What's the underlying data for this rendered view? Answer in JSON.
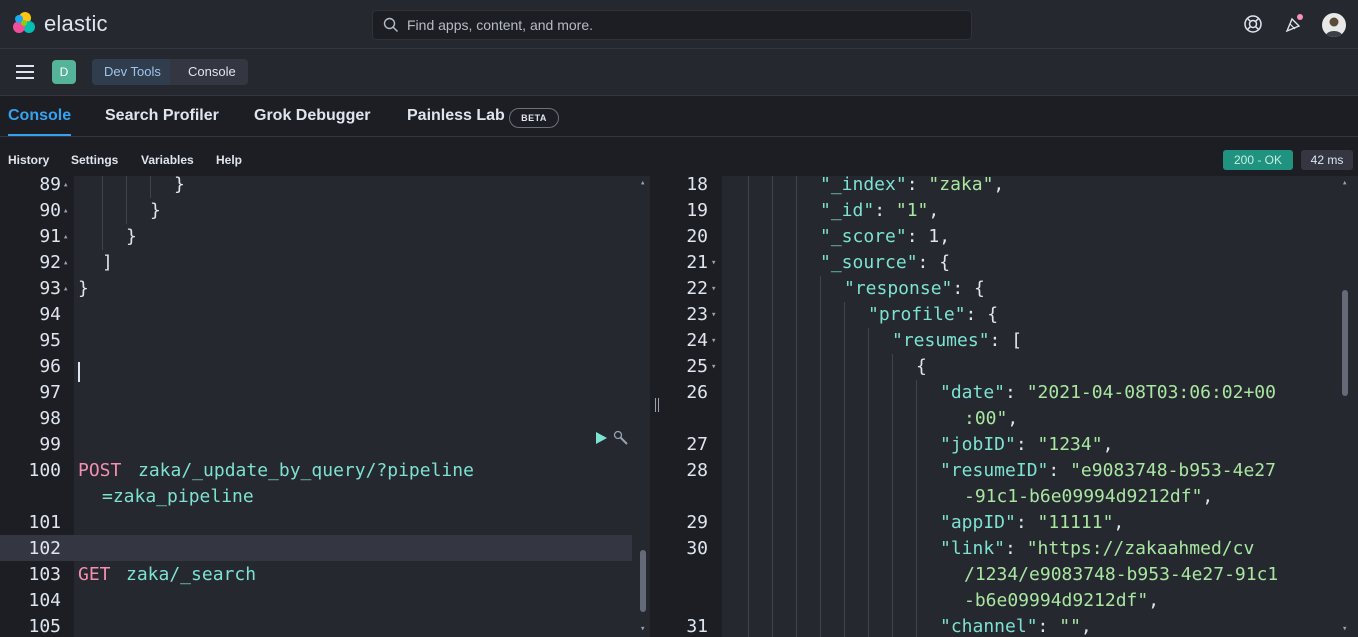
{
  "header": {
    "logo_text": "elastic",
    "search_placeholder": "Find apps, content, and more.",
    "icons": [
      "elastic-logo-icon",
      "search-icon",
      "help-icon",
      "newsfeed-icon",
      "user-avatar"
    ]
  },
  "breadcrumbs": {
    "space_initial": "D",
    "items": [
      "Dev Tools",
      "Console"
    ]
  },
  "tabs": [
    {
      "label": "Console",
      "active": true
    },
    {
      "label": "Search Profiler",
      "active": false
    },
    {
      "label": "Grok Debugger",
      "active": false
    },
    {
      "label": "Painless Lab",
      "active": false
    }
  ],
  "beta_badge": "BETA",
  "console_menu": [
    "History",
    "Settings",
    "Variables",
    "Help"
  ],
  "response_status": "200 - OK",
  "response_time": "42 ms",
  "request_editor": {
    "line_numbers": [
      "89",
      "90",
      "91",
      "92",
      "93",
      "94",
      "95",
      "96",
      "97",
      "98",
      "99",
      "100",
      "",
      "101",
      "102",
      "103",
      "104",
      "105"
    ],
    "lines": {
      "l89": "}",
      "l90": "}",
      "l91": "}",
      "l92": "]",
      "l93": "}",
      "post_method": "POST",
      "post_url_1": "zaka/_update_by_query/?pipeline",
      "post_url_2": "=zaka_pipeline",
      "get_method": "GET",
      "get_url": "zaka/_search"
    },
    "action_icons": [
      "play-icon",
      "wrench-icon"
    ]
  },
  "response_editor": {
    "line_numbers": [
      "18",
      "19",
      "20",
      "21",
      "22",
      "23",
      "24",
      "25",
      "26",
      "",
      "27",
      "28",
      "",
      "29",
      "30",
      "",
      "",
      "31"
    ],
    "lines": {
      "l18_key": "\"_index\"",
      "l18_val": "\"zaka\"",
      "l19_key": "\"_id\"",
      "l19_val": "\"1\"",
      "l20_key": "\"_score\"",
      "l20_val": "1",
      "l21_key": "\"_source\"",
      "l22_key": "\"response\"",
      "l23_key": "\"profile\"",
      "l24_key": "\"resumes\"",
      "l25": "{",
      "l26_key": "\"date\"",
      "l26_val_1": "\"2021-04-08T03:06:02+00",
      "l26_val_2": ":00\"",
      "l27_key": "\"jobID\"",
      "l27_val": "\"1234\"",
      "l28_key": "\"resumeID\"",
      "l28_val_1": "\"e9083748-b953-4e27",
      "l28_val_2": "-91c1-b6e09994d9212df\"",
      "l29_key": "\"appID\"",
      "l29_val": "\"11111\"",
      "l30_key": "\"link\"",
      "l30_val_1": "\"https://zakaahmed/cv",
      "l30_val_2": "/1234/e9083748-b953-4e27-91c1",
      "l30_val_3": "-b6e09994d9212df\"",
      "l31_key": "\"channel\"",
      "l31_val": "\"\""
    }
  },
  "colors": {
    "accent": "#36a2ef",
    "status_ok": "#209280",
    "space_badge": "#54b399",
    "method": "#f48fb1",
    "url": "#7de2d1",
    "string": "#a8e6a1"
  }
}
